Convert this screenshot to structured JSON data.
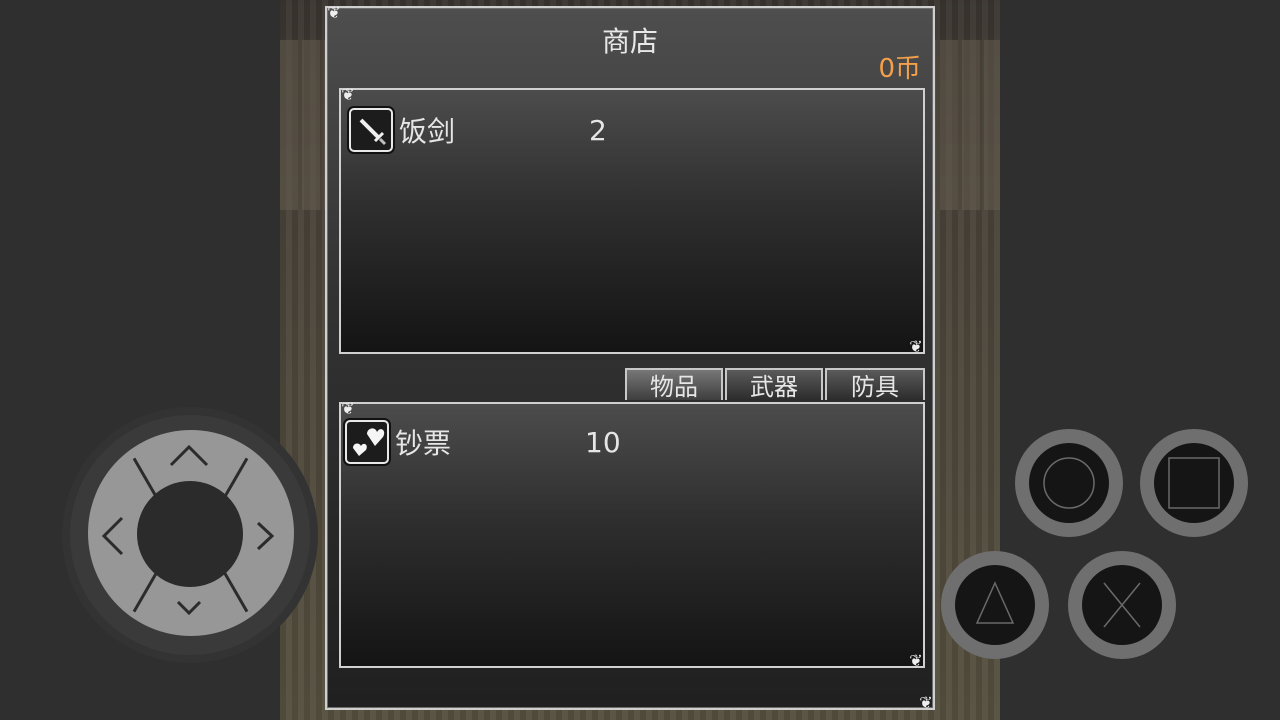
{
  "window": {
    "title": "商店",
    "coins": "0币"
  },
  "shop_items": [
    {
      "name": "饭剑",
      "qty": "2",
      "icon": "sword-icon"
    }
  ],
  "tabs": [
    {
      "label": "物品",
      "active": true
    },
    {
      "label": "武器",
      "active": false
    },
    {
      "label": "防具",
      "active": false
    }
  ],
  "inventory_items": [
    {
      "name": "钞票",
      "qty": "10",
      "icon": "hearts-icon"
    }
  ],
  "controls": {
    "dpad_icons": [
      "up-arrow-icon",
      "down-arrow-icon",
      "left-arrow-icon",
      "right-arrow-icon"
    ],
    "action_buttons": [
      "circle-icon",
      "square-icon",
      "triangle-icon",
      "cross-icon"
    ]
  },
  "colors": {
    "coins": "#f4a04b",
    "border": "#d0d0d0"
  }
}
